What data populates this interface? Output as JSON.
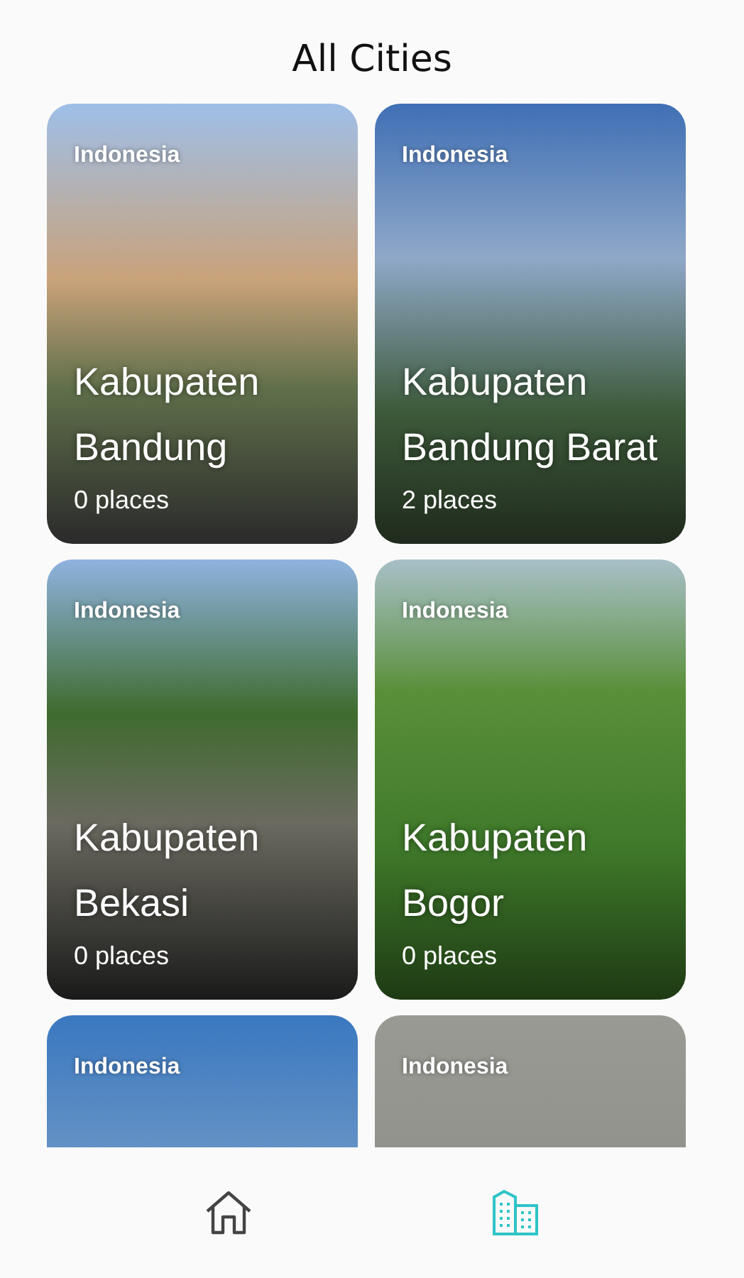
{
  "header": {
    "title": "All Cities"
  },
  "cities": [
    {
      "country": "Indonesia",
      "name": "Kabupaten Bandung",
      "places": "0 places"
    },
    {
      "country": "Indonesia",
      "name": "Kabupaten Bandung Barat",
      "places": "2 places"
    },
    {
      "country": "Indonesia",
      "name": "Kabupaten Bekasi",
      "places": "0 places"
    },
    {
      "country": "Indonesia",
      "name": "Kabupaten Bogor",
      "places": "0 places"
    },
    {
      "country": "Indonesia"
    },
    {
      "country": "Indonesia"
    }
  ],
  "bottom_nav": [
    {
      "kind": "home",
      "selected": false
    },
    {
      "kind": "cities",
      "selected": true
    }
  ]
}
